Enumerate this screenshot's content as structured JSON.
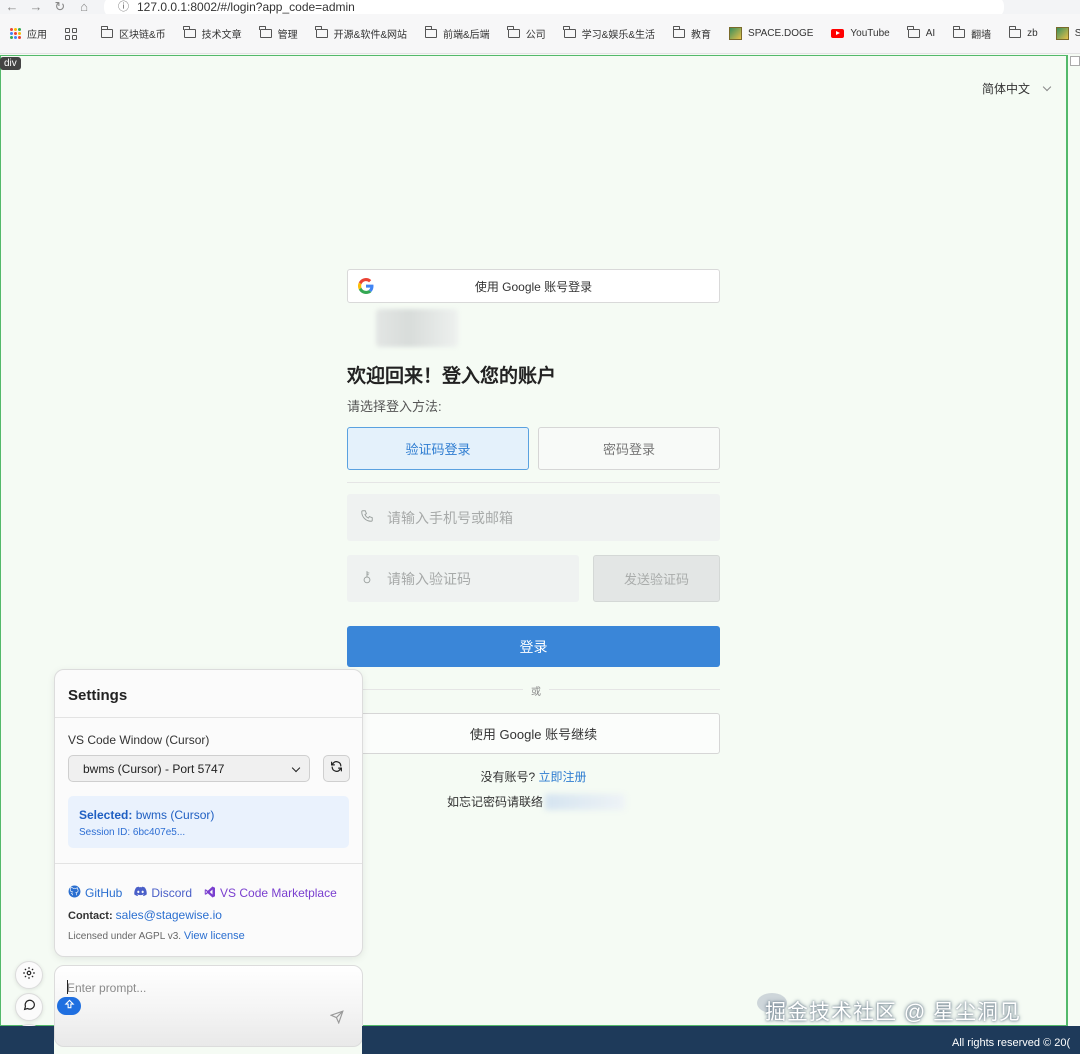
{
  "browser": {
    "url": "127.0.0.1:8002/#/login?app_code=admin",
    "bookmarks": [
      {
        "label": "应用",
        "icon": "apps-icon"
      },
      {
        "label": "",
        "icon": "grid-icon"
      },
      {
        "label": "区块链&币",
        "icon": "folder-icon"
      },
      {
        "label": "技术文章",
        "icon": "folder-icon"
      },
      {
        "label": "管理",
        "icon": "folder-icon"
      },
      {
        "label": "开源&软件&网站",
        "icon": "folder-icon"
      },
      {
        "label": "前端&后端",
        "icon": "folder-icon"
      },
      {
        "label": "公司",
        "icon": "folder-icon"
      },
      {
        "label": "学习&娱乐&生活",
        "icon": "folder-icon"
      },
      {
        "label": "教育",
        "icon": "folder-icon"
      },
      {
        "label": "SPACE.DOGE",
        "icon": "image-icon"
      },
      {
        "label": "YouTube",
        "icon": "youtube-icon"
      },
      {
        "label": "AI",
        "icon": "folder-icon"
      },
      {
        "label": "翻墙",
        "icon": "folder-icon"
      },
      {
        "label": "zb",
        "icon": "folder-icon"
      },
      {
        "label": "SP",
        "icon": "image-icon"
      }
    ]
  },
  "inspector": {
    "tag": "div"
  },
  "header": {
    "language": "简体中文"
  },
  "login": {
    "google_top": "使用 Google 账号登录",
    "welcome": "欢迎回来！登入您的账户",
    "choose_method": "请选择登入方法:",
    "tab_code": "验证码登录",
    "tab_password": "密码登录",
    "phone_placeholder": "请输入手机号或邮箱",
    "code_placeholder": "请输入验证码",
    "send_code": "发送验证码",
    "submit": "登录",
    "or": "或",
    "google_continue": "使用 Google 账号继续",
    "no_account": "没有账号?",
    "register": "立即注册",
    "forgot": "如忘记密码请联络"
  },
  "settings": {
    "title": "Settings",
    "window_label": "VS Code Window (Cursor)",
    "window_selected": "bwms (Cursor) - Port 5747",
    "selected_label": "Selected:",
    "selected_value": "bwms (Cursor)",
    "session": "Session ID: 6bc407e5...",
    "github": "GitHub",
    "discord": "Discord",
    "marketplace": "VS Code Marketplace",
    "contact_label": "Contact:",
    "contact_email": "sales@stagewise.io",
    "license_text": "Licensed under AGPL v3.",
    "license_link": "View license"
  },
  "prompt": {
    "placeholder": "Enter prompt..."
  },
  "footer": {
    "rights": "All rights reserved © 20("
  },
  "watermark": "掘金技术社区 @ 星尘洞见",
  "colors": {
    "primary": "#3a86d8",
    "frame": "#53b96a",
    "footer": "#1e3a5a"
  }
}
